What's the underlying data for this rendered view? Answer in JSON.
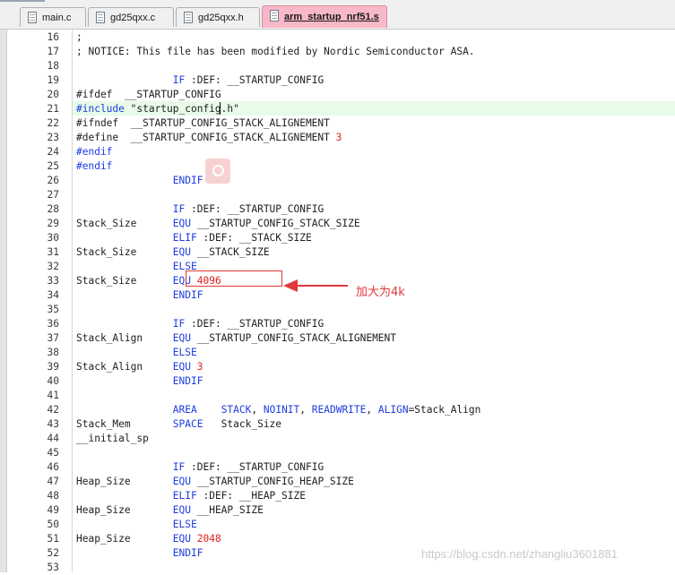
{
  "tabs": [
    {
      "label": "main.c",
      "active": false
    },
    {
      "label": "gd25qxx.c",
      "active": false
    },
    {
      "label": "gd25qxx.h",
      "active": false
    },
    {
      "label": "arm_startup_nrf51.s",
      "active": true
    }
  ],
  "lines": [
    {
      "n": "16",
      "parts": [
        {
          "t": ";",
          "c": "cmt"
        }
      ]
    },
    {
      "n": "17",
      "parts": [
        {
          "t": "; NOTICE: This file has been modified by Nordic Semiconductor ASA.",
          "c": "cmt"
        }
      ]
    },
    {
      "n": "18",
      "parts": []
    },
    {
      "n": "19",
      "parts": [
        {
          "t": "                IF :DEF: __STARTUP_CONFIG",
          "c": "kwmix1"
        }
      ]
    },
    {
      "n": "20",
      "parts": [
        {
          "t": "#ifdef  __STARTUP_CONFIG",
          "c": ""
        }
      ]
    },
    {
      "n": "21",
      "parts": [
        {
          "t": "#include",
          "c": "kw"
        },
        {
          "t": " \"startup_config.h\"",
          "c": "str"
        }
      ]
    },
    {
      "n": "22",
      "parts": [
        {
          "t": "#ifndef  __STARTUP_CONFIG_STACK_ALIGNEMENT",
          "c": ""
        }
      ]
    },
    {
      "n": "23",
      "parts": [
        {
          "t": "#define  __STARTUP_CONFIG_STACK_ALIGNEMENT ",
          "c": ""
        },
        {
          "t": "3",
          "c": "num"
        }
      ]
    },
    {
      "n": "24",
      "parts": [
        {
          "t": "#endif",
          "c": "kw"
        }
      ]
    },
    {
      "n": "25",
      "parts": [
        {
          "t": "#endif",
          "c": "kw"
        }
      ]
    },
    {
      "n": "26",
      "parts": [
        {
          "t": "                ",
          "c": ""
        },
        {
          "t": "ENDIF",
          "c": "kw"
        }
      ]
    },
    {
      "n": "27",
      "parts": []
    },
    {
      "n": "28",
      "parts": [
        {
          "t": "                ",
          "c": ""
        },
        {
          "t": "IF",
          "c": "kw"
        },
        {
          "t": " :DEF: __STARTUP_CONFIG",
          "c": ""
        }
      ]
    },
    {
      "n": "29",
      "parts": [
        {
          "t": "Stack_Size      ",
          "c": ""
        },
        {
          "t": "EQU",
          "c": "kw"
        },
        {
          "t": " __STARTUP_CONFIG_STACK_SIZE",
          "c": ""
        }
      ]
    },
    {
      "n": "30",
      "parts": [
        {
          "t": "                ",
          "c": ""
        },
        {
          "t": "ELIF",
          "c": "kw"
        },
        {
          "t": " :DEF: __STACK_SIZE",
          "c": ""
        }
      ]
    },
    {
      "n": "31",
      "parts": [
        {
          "t": "Stack_Size      ",
          "c": ""
        },
        {
          "t": "EQU",
          "c": "kw"
        },
        {
          "t": " __STACK_SIZE",
          "c": ""
        }
      ]
    },
    {
      "n": "32",
      "parts": [
        {
          "t": "                ",
          "c": ""
        },
        {
          "t": "ELSE",
          "c": "kw"
        }
      ]
    },
    {
      "n": "33",
      "parts": [
        {
          "t": "Stack_Size      ",
          "c": ""
        },
        {
          "t": "EQU",
          "c": "kw"
        },
        {
          "t": " ",
          "c": ""
        },
        {
          "t": "4096",
          "c": "num"
        }
      ]
    },
    {
      "n": "34",
      "parts": [
        {
          "t": "                ",
          "c": ""
        },
        {
          "t": "ENDIF",
          "c": "kw"
        }
      ]
    },
    {
      "n": "35",
      "parts": []
    },
    {
      "n": "36",
      "parts": [
        {
          "t": "                ",
          "c": ""
        },
        {
          "t": "IF",
          "c": "kw"
        },
        {
          "t": " :DEF: __STARTUP_CONFIG",
          "c": ""
        }
      ]
    },
    {
      "n": "37",
      "parts": [
        {
          "t": "Stack_Align     ",
          "c": ""
        },
        {
          "t": "EQU",
          "c": "kw"
        },
        {
          "t": " __STARTUP_CONFIG_STACK_ALIGNEMENT",
          "c": ""
        }
      ]
    },
    {
      "n": "38",
      "parts": [
        {
          "t": "                ",
          "c": ""
        },
        {
          "t": "ELSE",
          "c": "kw"
        }
      ]
    },
    {
      "n": "39",
      "parts": [
        {
          "t": "Stack_Align     ",
          "c": ""
        },
        {
          "t": "EQU",
          "c": "kw"
        },
        {
          "t": " ",
          "c": ""
        },
        {
          "t": "3",
          "c": "num"
        }
      ]
    },
    {
      "n": "40",
      "parts": [
        {
          "t": "                ",
          "c": ""
        },
        {
          "t": "ENDIF",
          "c": "kw"
        }
      ]
    },
    {
      "n": "41",
      "parts": []
    },
    {
      "n": "42",
      "parts": [
        {
          "t": "                ",
          "c": ""
        },
        {
          "t": "AREA",
          "c": "kw"
        },
        {
          "t": "    ",
          "c": ""
        },
        {
          "t": "STACK",
          "c": "kw"
        },
        {
          "t": ", ",
          "c": ""
        },
        {
          "t": "NOINIT",
          "c": "kw"
        },
        {
          "t": ", ",
          "c": ""
        },
        {
          "t": "READWRITE",
          "c": "kw"
        },
        {
          "t": ", ",
          "c": ""
        },
        {
          "t": "ALIGN",
          "c": "kw"
        },
        {
          "t": "=Stack_Align",
          "c": ""
        }
      ]
    },
    {
      "n": "43",
      "parts": [
        {
          "t": "Stack_Mem       ",
          "c": ""
        },
        {
          "t": "SPACE",
          "c": "kw"
        },
        {
          "t": "   Stack_Size",
          "c": ""
        }
      ]
    },
    {
      "n": "44",
      "parts": [
        {
          "t": "__initial_sp",
          "c": ""
        }
      ]
    },
    {
      "n": "45",
      "parts": []
    },
    {
      "n": "46",
      "parts": [
        {
          "t": "                ",
          "c": ""
        },
        {
          "t": "IF",
          "c": "kw"
        },
        {
          "t": " :DEF: __STARTUP_CONFIG",
          "c": ""
        }
      ]
    },
    {
      "n": "47",
      "parts": [
        {
          "t": "Heap_Size       ",
          "c": ""
        },
        {
          "t": "EQU",
          "c": "kw"
        },
        {
          "t": " __STARTUP_CONFIG_HEAP_SIZE",
          "c": ""
        }
      ]
    },
    {
      "n": "48",
      "parts": [
        {
          "t": "                ",
          "c": ""
        },
        {
          "t": "ELIF",
          "c": "kw"
        },
        {
          "t": " :DEF: __HEAP_SIZE",
          "c": ""
        }
      ]
    },
    {
      "n": "49",
      "parts": [
        {
          "t": "Heap_Size       ",
          "c": ""
        },
        {
          "t": "EQU",
          "c": "kw"
        },
        {
          "t": " __HEAP_SIZE",
          "c": ""
        }
      ]
    },
    {
      "n": "50",
      "parts": [
        {
          "t": "                ",
          "c": ""
        },
        {
          "t": "ELSE",
          "c": "kw"
        }
      ]
    },
    {
      "n": "51",
      "parts": [
        {
          "t": "Heap_Size       ",
          "c": ""
        },
        {
          "t": "EQU",
          "c": "kw"
        },
        {
          "t": " ",
          "c": ""
        },
        {
          "t": "2048",
          "c": "num"
        }
      ]
    },
    {
      "n": "52",
      "parts": [
        {
          "t": "                ",
          "c": ""
        },
        {
          "t": "ENDIF",
          "c": "kw"
        }
      ]
    },
    {
      "n": "53",
      "parts": []
    }
  ],
  "annotation": {
    "text": "加大为4k"
  },
  "watermark": {
    "text": "https://blog.csdn.net/zhangliu3601881"
  },
  "colors": {
    "keyword": "#1e3ce0",
    "number": "#e02020",
    "annotation": "#e0383a",
    "active_tab": "#f7b8c8",
    "current_line": "#e8fbe8"
  },
  "icons": {
    "file_tab": "file-icon",
    "overlay": "search-icon"
  }
}
